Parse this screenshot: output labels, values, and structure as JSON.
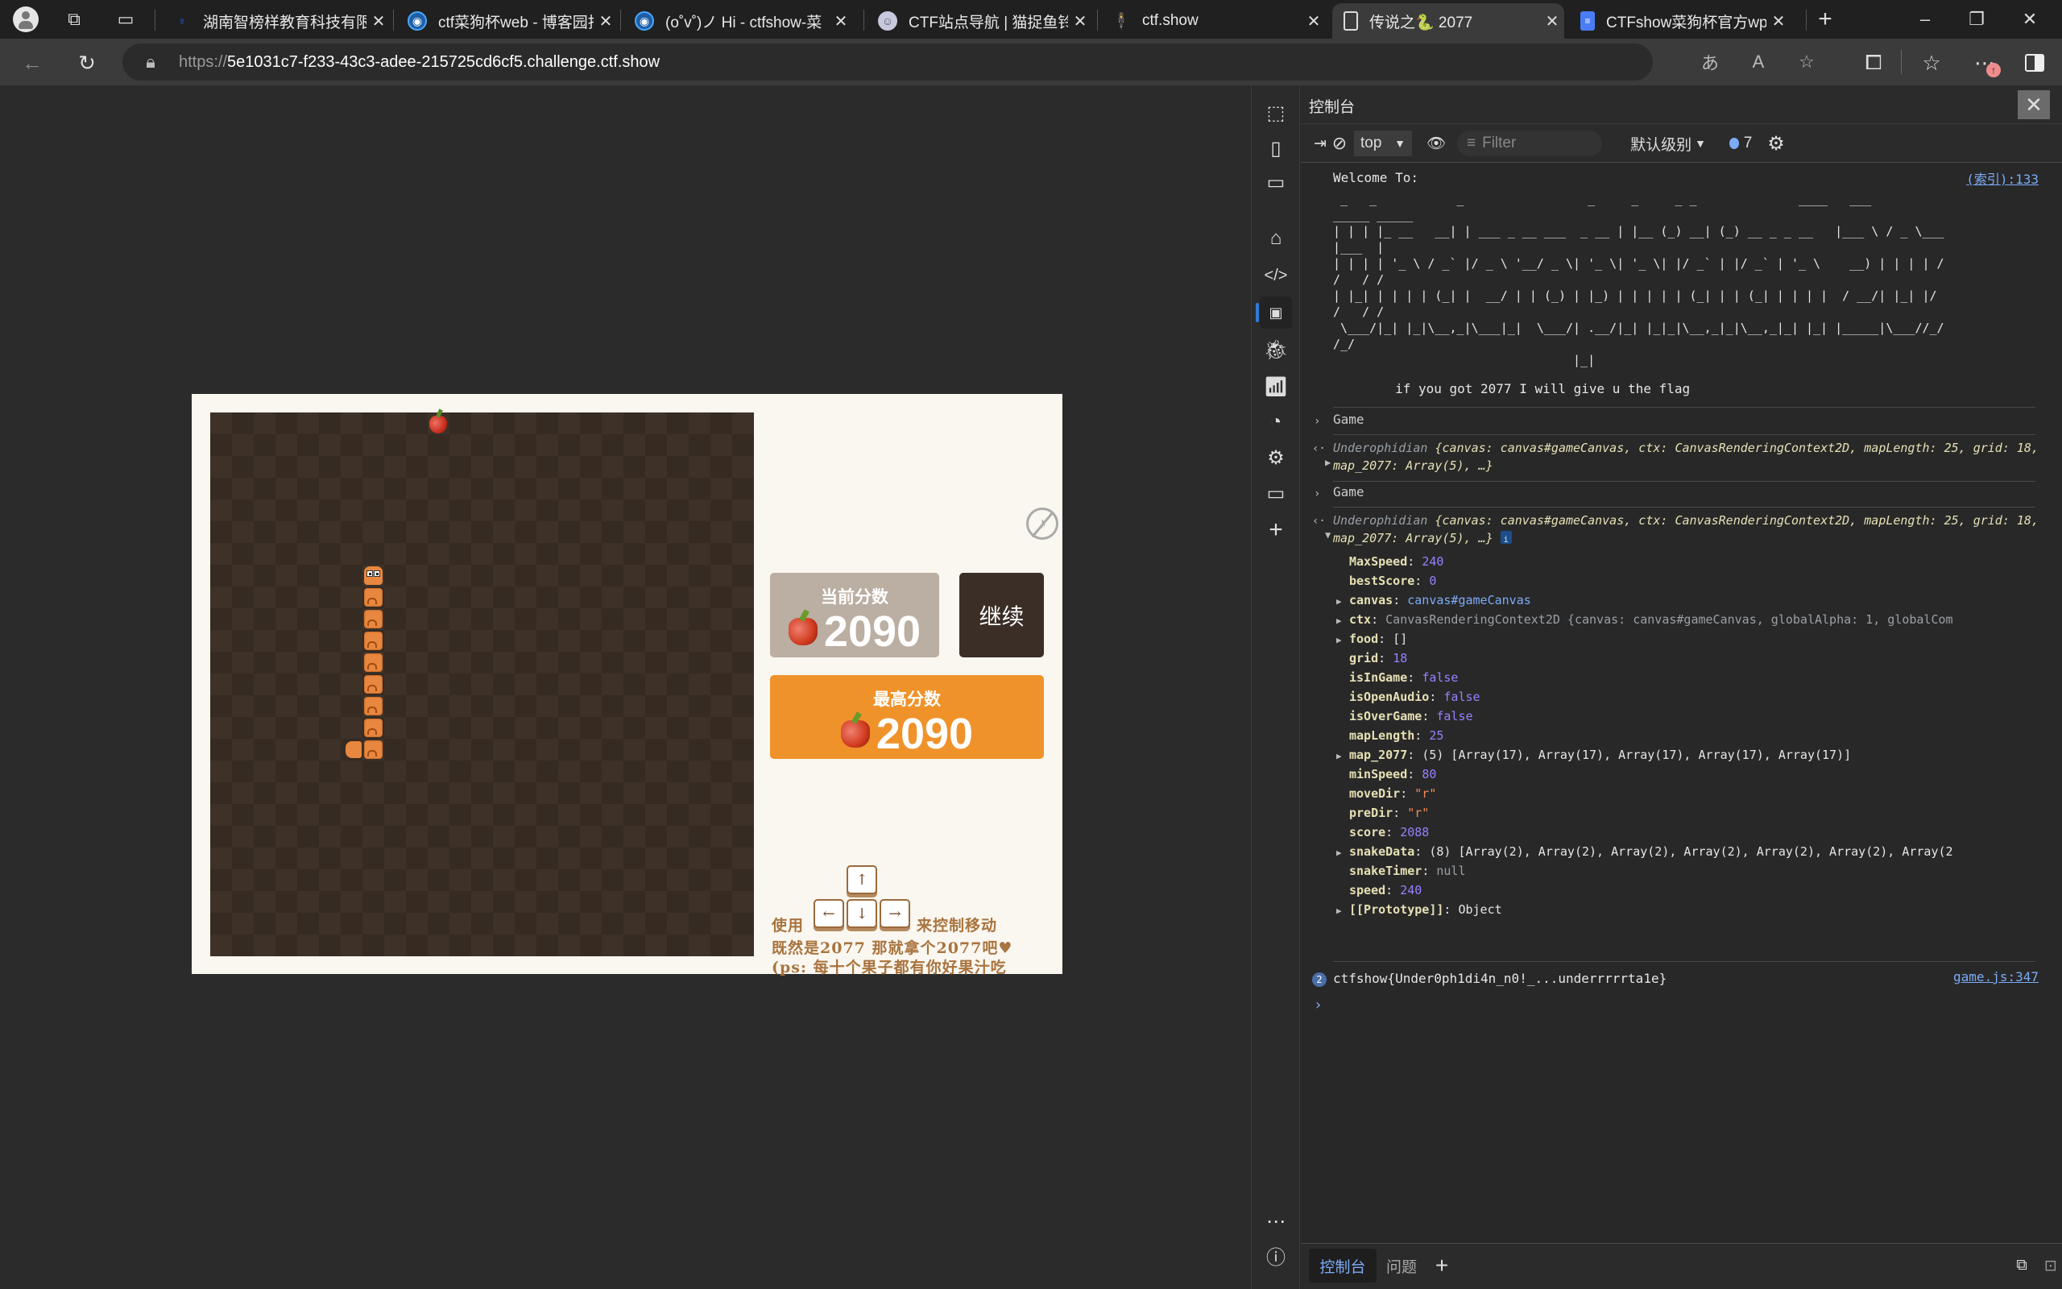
{
  "browser": {
    "tabs": [
      {
        "title": "湖南智榜样教育科技有限",
        "icon": "bank-logo-icon",
        "color": "#2b5ce6"
      },
      {
        "title": "ctf菜狗杯web - 博客园找",
        "icon": "blog-icon",
        "color": "#1e88e5"
      },
      {
        "title": "(o˚v˚)ノ Hi - ctfshow-菜",
        "icon": "blog-icon",
        "color": "#1e88e5"
      },
      {
        "title": "CTF站点导航 | 猫捉鱼铃",
        "icon": "anime-avatar-icon",
        "color": "#aab"
      },
      {
        "title": "ctf.show",
        "icon": "ctfshow-logo-icon",
        "color": "#111"
      },
      {
        "title": "传说之🐍 2077",
        "icon": "page-icon",
        "color": "#ddd",
        "active": true
      },
      {
        "title": "CTFshow菜狗杯官方wp ·",
        "icon": "docs-icon",
        "color": "#4a7cf6"
      }
    ],
    "new_tab": "+",
    "url_protocol": "https://",
    "url_host": "5e1031c7-f233-43c3-adee-215725cd6cf5.challenge.ctf.show",
    "window_controls": {
      "minimize": "–",
      "restore": "❐",
      "close": "✕"
    }
  },
  "game": {
    "current_score_label": "当前分数",
    "current_score": "2090",
    "best_score_label": "最高分数",
    "best_score": "2090",
    "continue_label": "继续",
    "help_use": "使用",
    "help_control": "来控制移动",
    "help_line2": "既然是2077 那就拿个2077吧♥",
    "help_line3": "(ps: 每十个果子都有你好果汁吃",
    "keys": {
      "up": "↑",
      "left": "←",
      "down": "↓",
      "right": "→"
    },
    "board_cells": 25,
    "snake": {
      "head": [
        7,
        7
      ],
      "body_col": 7,
      "body_rows": [
        8,
        9,
        10,
        11,
        12,
        13,
        14,
        15
      ],
      "tail": [
        6,
        15
      ]
    },
    "food": [
      10,
      0
    ],
    "colors": {
      "board_dark": "#352b22",
      "board_light": "#3d3128",
      "panel": "#faf7f0",
      "accent": "#f0922a"
    }
  },
  "devtools": {
    "title": "控制台",
    "context": "top",
    "filter_placeholder": "Filter",
    "level": "默认级别",
    "issues_count": "7",
    "welcome": "Welcome To:",
    "welcome_src": "(索引):133",
    "ascii_art": [
      " _   _           _                 _     _     _ _              ____   ___",
      "_____ _____",
      "| | | |_ __   __| | ___ _ __ ___  _ __ | |__ (_) __| (_) __ _ _ __   |___ \\ / _ \\___",
      "|___  |",
      "| | | | '_ \\ / _` |/ _ \\ '__/ _ \\| '_ \\| '_ \\| |/ _` | |/ _` | '_ \\    __) | | | | /",
      "/   / /",
      "| |_| | | | | (_| |  __/ | | (_) | |_) | | | | | (_| | | (_| | | | |  / __/| |_| |/",
      "/   / /",
      " \\___/|_| |_|\\__,_|\\___|_|  \\___/| .__/|_| |_|_|\\__,_|_|\\__,_|_| |_| |_____|\\___//_/",
      "/_/",
      "                                 |_|"
    ],
    "flag_hint": "        if you got 2077 I will give u the flag",
    "entries": [
      {
        "input": "Game",
        "output_class": "Underophidian",
        "preview": "{canvas: canvas#gameCanvas, ctx: CanvasRenderingContext2D, mapLength: 25, grid: 18, map_2077: Array(5), …}"
      },
      {
        "input": "Game",
        "output_class": "Underophidian",
        "preview": "{canvas: canvas#gameCanvas, ctx: CanvasRenderingContext2D, mapLength: 25, grid: 18, map_2077: Array(5), …}"
      }
    ],
    "properties": [
      {
        "key": "MaxSpeed",
        "value": "240",
        "type": "num",
        "expandable": false
      },
      {
        "key": "bestScore",
        "value": "0",
        "type": "num",
        "expandable": false
      },
      {
        "key": "canvas",
        "value": "canvas#gameCanvas",
        "type": "node",
        "expandable": true
      },
      {
        "key": "ctx",
        "value": "CanvasRenderingContext2D {canvas: canvas#gameCanvas, globalAlpha: 1, globalCom",
        "type": "obj",
        "expandable": true
      },
      {
        "key": "food",
        "value": "[]",
        "type": "plain",
        "expandable": true
      },
      {
        "key": "grid",
        "value": "18",
        "type": "num",
        "expandable": false
      },
      {
        "key": "isInGame",
        "value": "false",
        "type": "num",
        "expandable": false
      },
      {
        "key": "isOpenAudio",
        "value": "false",
        "type": "num",
        "expandable": false
      },
      {
        "key": "isOverGame",
        "value": "false",
        "type": "num",
        "expandable": false
      },
      {
        "key": "mapLength",
        "value": "25",
        "type": "num",
        "expandable": false
      },
      {
        "key": "map_2077",
        "value": "(5) [Array(17), Array(17), Array(17), Array(17), Array(17)]",
        "type": "plain",
        "expandable": true
      },
      {
        "key": "minSpeed",
        "value": "80",
        "type": "num",
        "expandable": false
      },
      {
        "key": "moveDir",
        "value": "\"r\"",
        "type": "str",
        "expandable": false
      },
      {
        "key": "preDir",
        "value": "\"r\"",
        "type": "str",
        "expandable": false
      },
      {
        "key": "score",
        "value": "2088",
        "type": "num",
        "expandable": false
      },
      {
        "key": "snakeData",
        "value": "(8) [Array(2), Array(2), Array(2), Array(2), Array(2), Array(2), Array(2",
        "type": "plain",
        "expandable": true
      },
      {
        "key": "snakeTimer",
        "value": "null",
        "type": "null",
        "expandable": false
      },
      {
        "key": "speed",
        "value": "240",
        "type": "num",
        "expandable": false
      },
      {
        "key": "[[Prototype]]",
        "value": "Object",
        "type": "plain",
        "expandable": true
      }
    ],
    "flag_count": "2",
    "flag": "ctfshow{Under0ph1di4n_n0!_...underrrrrta1e}",
    "flag_src": "game.js:347",
    "prompt": "›",
    "bottom_tabs": [
      "控制台",
      "问题"
    ],
    "add_tab": "+"
  }
}
